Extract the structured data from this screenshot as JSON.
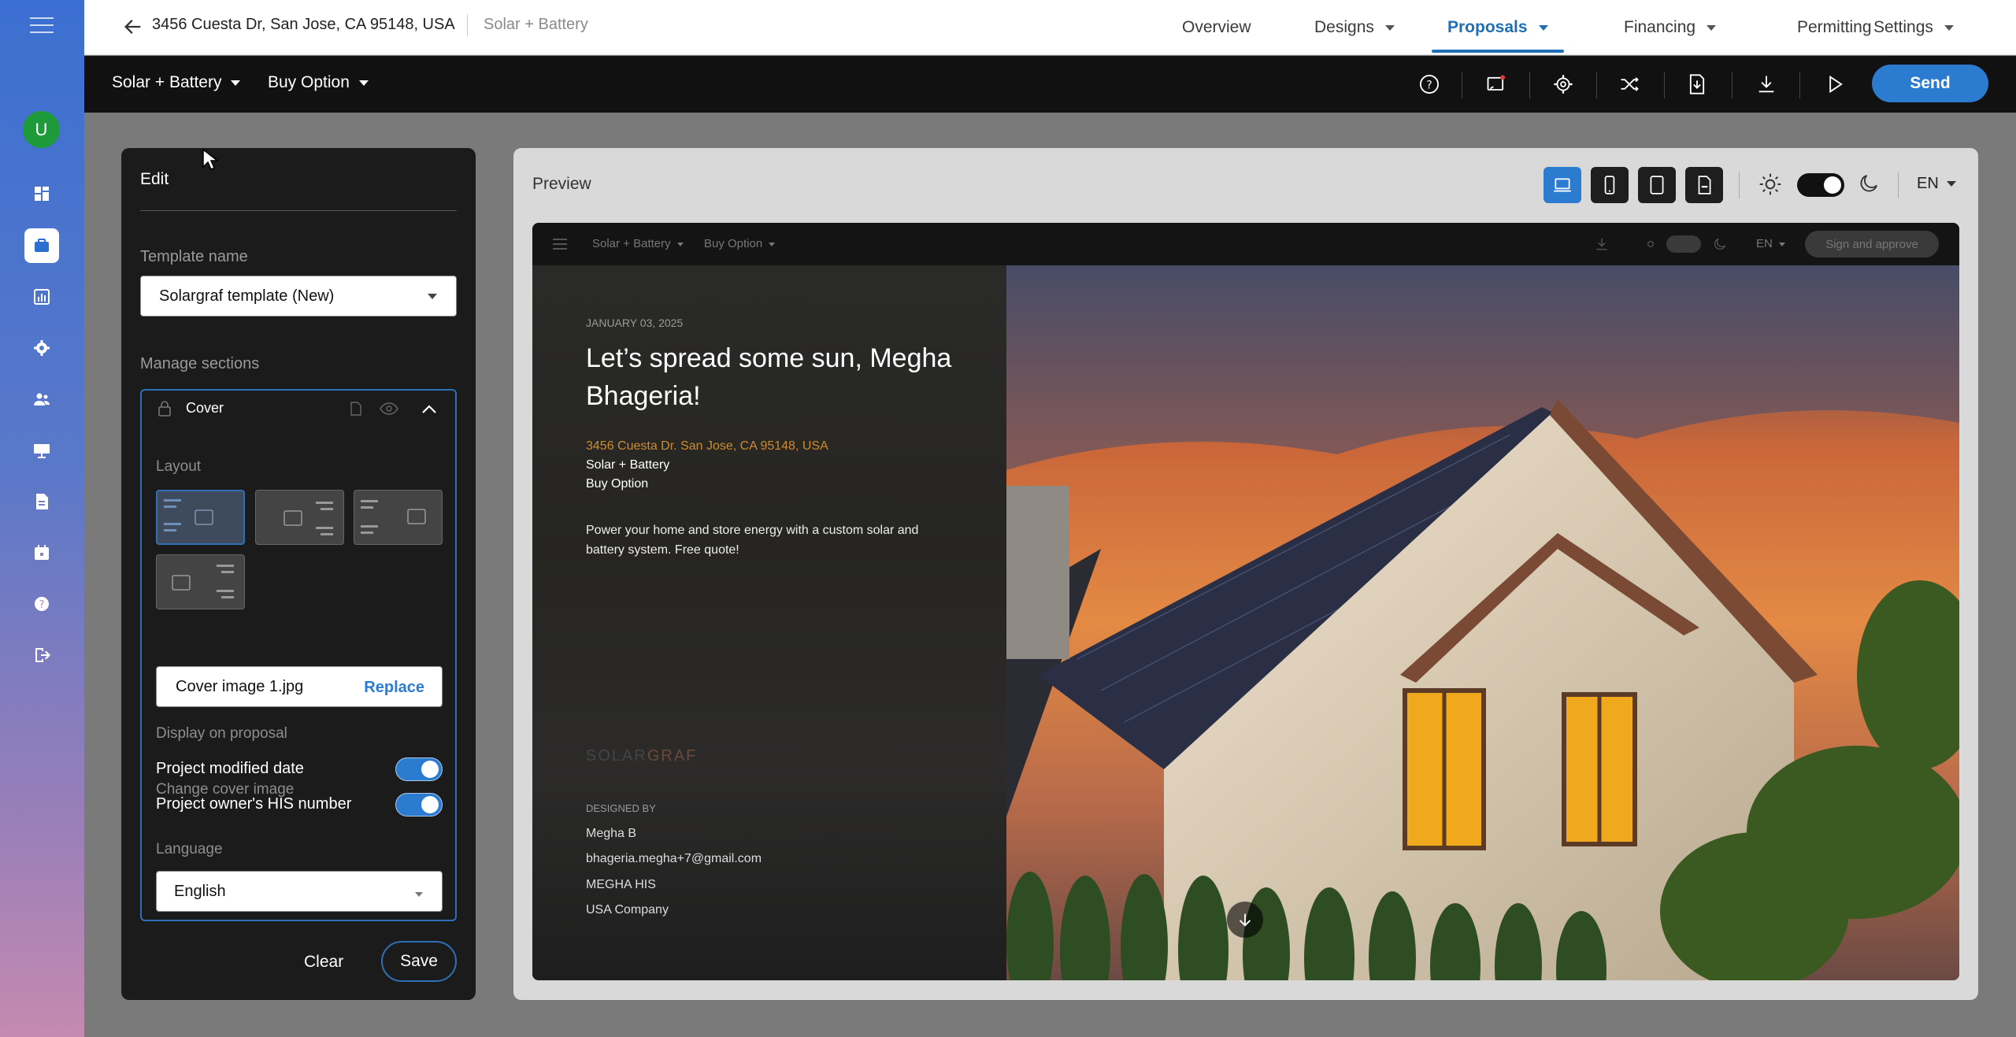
{
  "rail": {
    "avatar_initial": "U",
    "items": [
      "dashboard-icon",
      "briefcase-icon",
      "chart-icon",
      "gear-icon",
      "people-icon",
      "presentation-icon",
      "document-icon",
      "calendar-icon",
      "help-icon",
      "logout-icon"
    ]
  },
  "header": {
    "address": "3456 Cuesta Dr, San Jose, CA 95148, USA",
    "project": "Solar + Battery",
    "nav": [
      {
        "label": "Overview"
      },
      {
        "label": "Designs"
      },
      {
        "label": "Proposals"
      },
      {
        "label": "Financing"
      },
      {
        "label": "Permitting"
      },
      {
        "label": "Settings"
      }
    ],
    "active_tab": "Proposals"
  },
  "subbar": {
    "design_select": "Solar + Battery",
    "option_select": "Buy Option",
    "send_label": "Send"
  },
  "edit": {
    "title": "Edit",
    "template_name_label": "Template name",
    "template_name_value": "Solargraf template (New)",
    "manage_sections_label": "Manage sections",
    "section_name": "Cover",
    "layout_label": "Layout",
    "change_cover_label": "Change cover image",
    "cover_file": "Cover image 1.jpg",
    "replace_label": "Replace",
    "display_label": "Display on proposal",
    "toggle_modified": "Project modified date",
    "toggle_his": "Project owner's HIS number",
    "language_label": "Language",
    "language_value": "English",
    "clear_label": "Clear",
    "save_label": "Save"
  },
  "preview": {
    "title": "Preview",
    "lang": "EN",
    "doc": {
      "design_select": "Solar + Battery",
      "option_select": "Buy Option",
      "lang": "EN",
      "sign_label": "Sign and approve",
      "date": "JANUARY 03, 2025",
      "headline": "Let’s spread some sun, Megha Bhageria!",
      "address": "3456 Cuesta Dr. San Jose, CA 95148, USA",
      "project": "Solar + Battery",
      "option": "Buy Option",
      "blurb": "Power your home and store energy with a custom solar and battery system. Free quote!",
      "logo_a": "SOLAR",
      "logo_b": "GRAF",
      "designed_by_label": "DESIGNED BY",
      "designer_name": "Megha B",
      "designer_email": "bhageria.megha+7@gmail.com",
      "designer_his": "MEGHA HIS",
      "designer_company": "USA Company"
    }
  },
  "colors": {
    "accent": "#2b7bd0",
    "orange": "#d08b2d"
  }
}
